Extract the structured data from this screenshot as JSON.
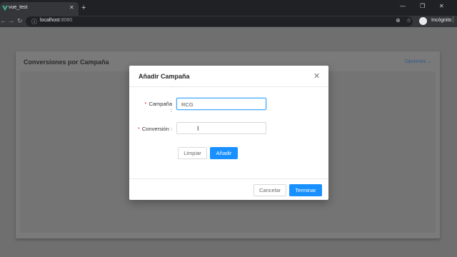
{
  "browser": {
    "tab_title": "vue_test",
    "tab_close": "✕",
    "new_tab": "+",
    "url_host": "localhost",
    "url_port": ":8080",
    "profile_label": "Incógnito",
    "window_controls": [
      "—",
      "❐",
      "✕"
    ]
  },
  "page": {
    "card_title": "Conversiones por Campaña",
    "options_label": "Opciones ⌄"
  },
  "modal": {
    "title": "Añadir Campaña",
    "fields": {
      "campaign_label": "Campaña",
      "campaign_value": "RCG",
      "conversion_label": "Conversión",
      "conversion_value": ""
    },
    "buttons": {
      "clear": "Limpiar",
      "add": "Añadir",
      "cancel": "Cancelar",
      "finish": "Terminar"
    }
  },
  "colors": {
    "primary": "#1890ff",
    "required": "#f5222d",
    "overlay": "#6f6f6f"
  }
}
